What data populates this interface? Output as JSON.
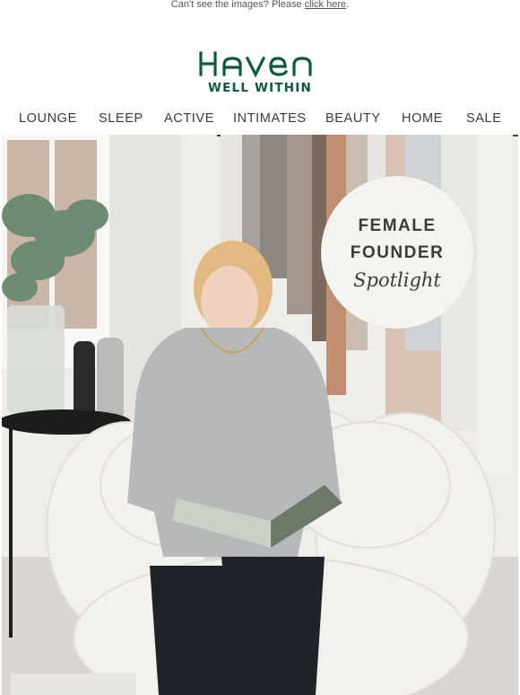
{
  "preheader": {
    "text": "Can't see the images? Please ",
    "link": "click here",
    "suffix": "."
  },
  "brand": {
    "name": "HAVEN",
    "tagline": "WELL WITHIN",
    "color": "#0e5a3c"
  },
  "nav": {
    "items": [
      "LOUNGE",
      "SLEEP",
      "ACTIVE",
      "INTIMATES",
      "BEAUTY",
      "HOME",
      "SALE"
    ]
  },
  "hero": {
    "badge": {
      "line1": "FEMALE",
      "line2": "FOUNDER",
      "line3": "Spotlight"
    }
  }
}
